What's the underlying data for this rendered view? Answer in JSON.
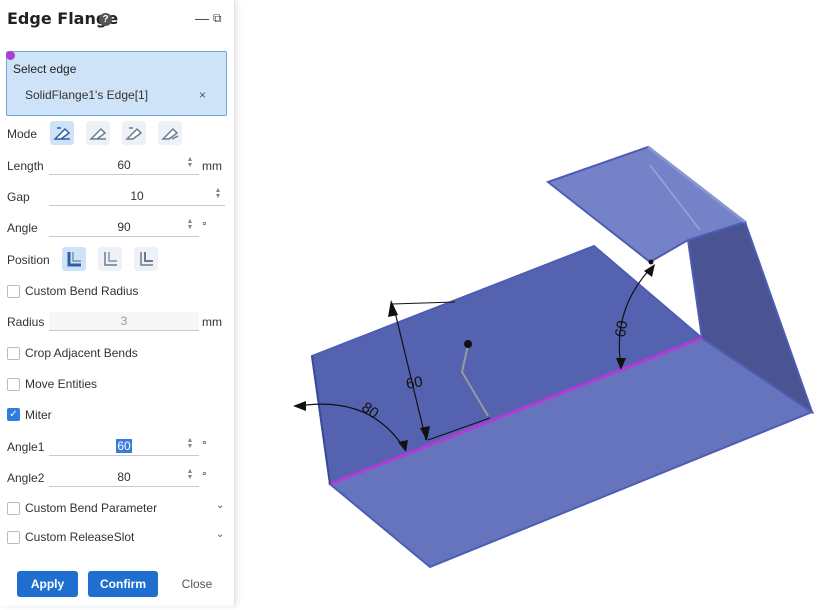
{
  "panel": {
    "title": "Edge Flange",
    "help_icon": "?",
    "minimize_label": "—",
    "restore_label": "⧉",
    "select": {
      "title": "Select edge",
      "item": "SolidFlange1's Edge[1]",
      "remove": "×"
    },
    "mode_label": "Mode",
    "length_label": "Length",
    "length_value": "60",
    "length_unit": "mm",
    "gap_label": "Gap",
    "gap_value": "10",
    "angle_label": "Angle",
    "angle_value": "90",
    "angle_unit": "°",
    "position_label": "Position",
    "custom_bend_radius": "Custom Bend Radius",
    "radius_label": "Radius",
    "radius_value": "3",
    "radius_unit": "mm",
    "crop_adjacent_bends": "Crop Adjacent Bends",
    "move_entities": "Move Entities",
    "miter": "Miter",
    "angle1_label": "Angle1",
    "angle1_value": "60",
    "angle1_unit": "°",
    "angle2_label": "Angle2",
    "angle2_value": "80",
    "angle2_unit": "°",
    "custom_bend_parameter": "Custom Bend Parameter",
    "custom_release_slot": "Custom ReleaseSlot",
    "apply": "Apply",
    "confirm": "Confirm",
    "close": "Close"
  },
  "viewport": {
    "dim_length": "60",
    "dim_angle1": "60",
    "dim_angle2": "80"
  },
  "colors": {
    "accent": "#1f6fd1",
    "selection": "#cfe3f8",
    "edge_highlight": "#b23bd6",
    "part_fill": "#5b6ab8"
  }
}
